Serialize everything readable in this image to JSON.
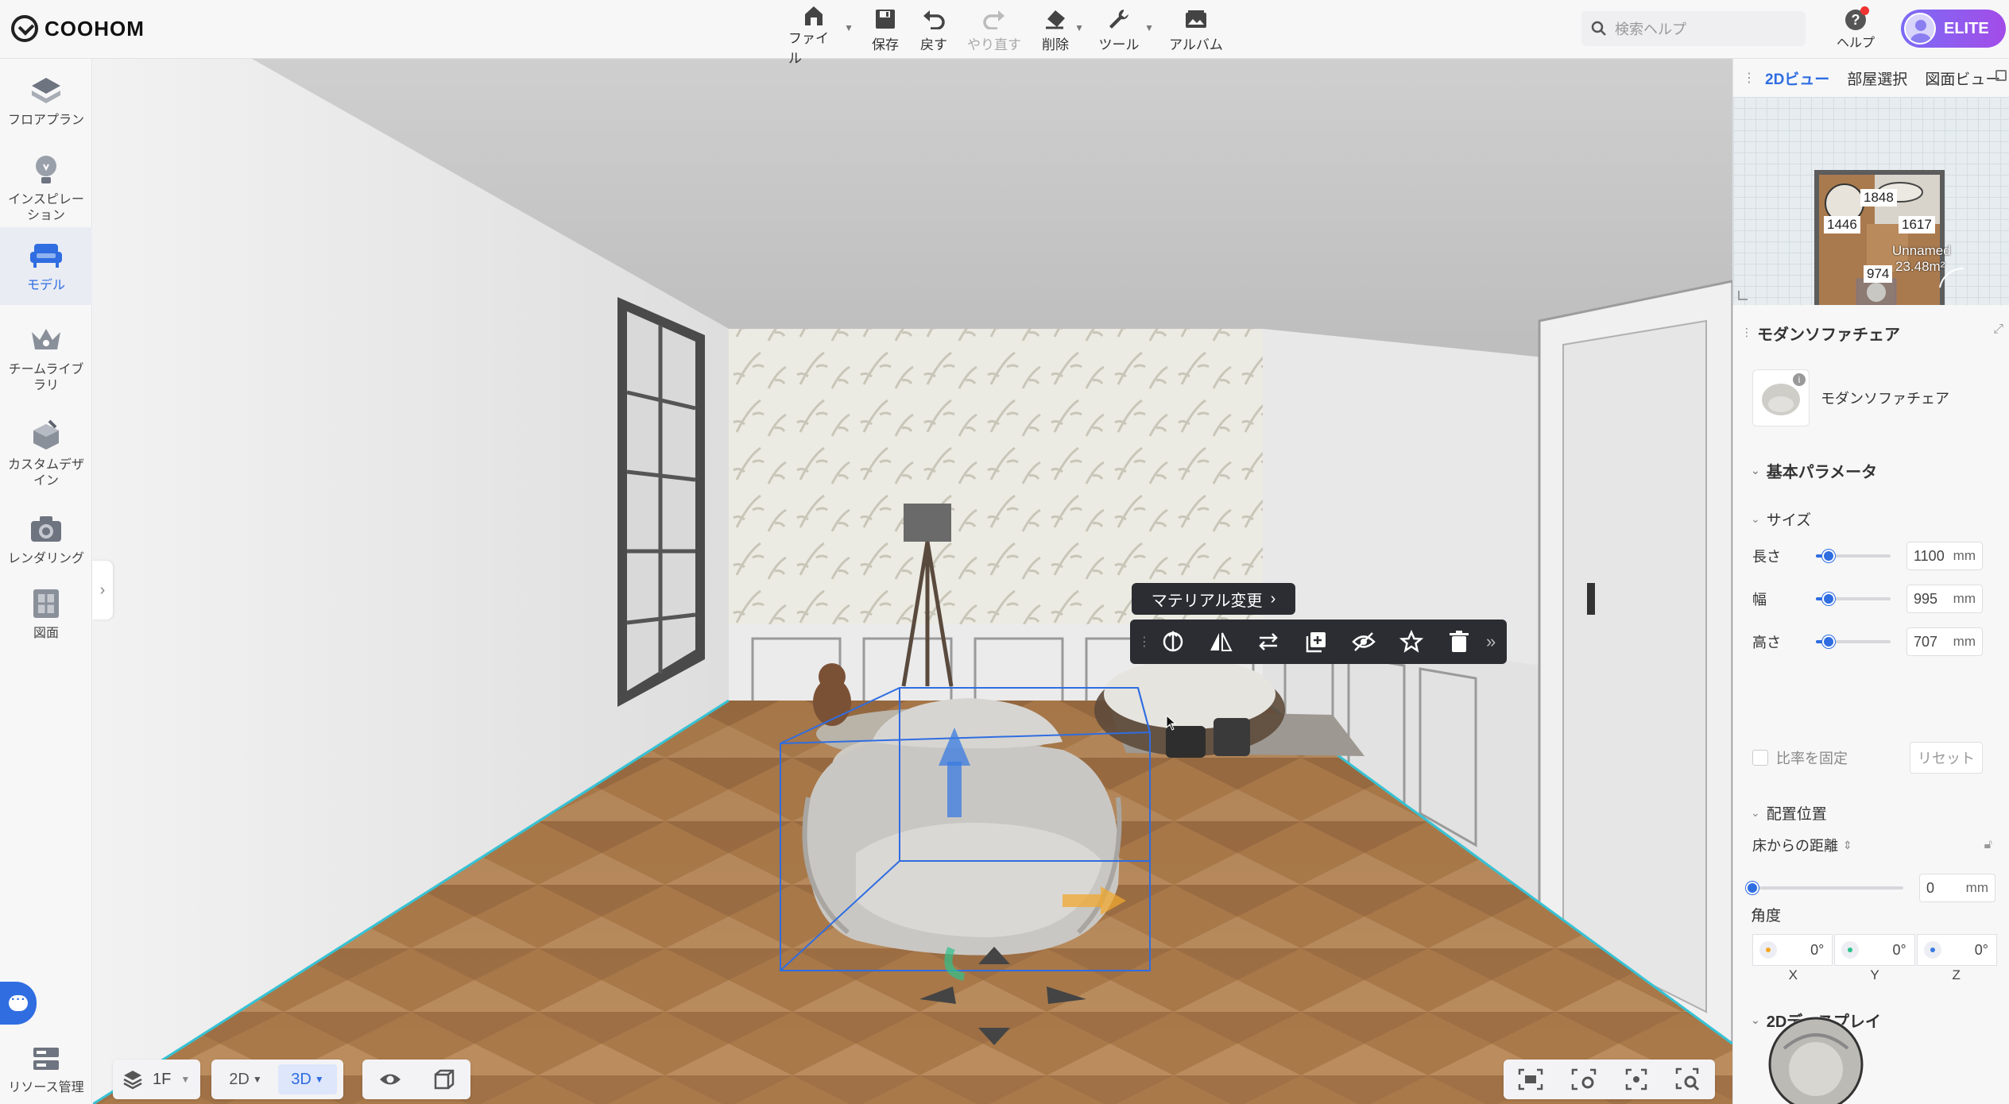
{
  "app": {
    "logo_text": "COOHOM"
  },
  "toolbar": {
    "file": "ファイル",
    "save": "保存",
    "undo": "戻す",
    "redo": "やり直す",
    "delete": "削除",
    "tools": "ツール",
    "album": "アルバム"
  },
  "search": {
    "placeholder": "検索ヘルプ"
  },
  "help": {
    "label": "ヘルプ"
  },
  "account": {
    "tier": "ELITE"
  },
  "sidebar": {
    "items": [
      {
        "label": "フロアプラン",
        "icon": "floorplan-icon"
      },
      {
        "label": "インスピレーション",
        "icon": "lightbulb-icon"
      },
      {
        "label": "モデル",
        "icon": "sofa-icon",
        "active": true
      },
      {
        "label": "チームライブラリ",
        "icon": "crown-icon"
      },
      {
        "label": "カスタムデザイン",
        "icon": "cube-edit-icon"
      },
      {
        "label": "レンダリング",
        "icon": "camera-icon"
      },
      {
        "label": "図面",
        "icon": "drawing-icon"
      }
    ],
    "resource": "リソース管理"
  },
  "viewport": {
    "material_change": "マテリアル変更",
    "floor": "1F",
    "view_2d": "2D",
    "view_3d": "3D"
  },
  "right_panel": {
    "tabs": [
      "2Dビュー",
      "部屋選択",
      "図面ビュー"
    ],
    "minimap": {
      "dim_top": "1848",
      "dim_left": "1446",
      "dim_right": "1617",
      "dim_bottom": "974",
      "room_name": "Unnamed",
      "room_area": "23.48m²"
    },
    "object_title": "モダンソファチェア",
    "object_name": "モダンソファチェア",
    "section_basic": "基本パラメータ",
    "section_size": "サイズ",
    "params": [
      {
        "label": "長さ",
        "value": "1100",
        "unit": "mm",
        "level": 0.17
      },
      {
        "label": "幅",
        "value": "995",
        "unit": "mm",
        "level": 0.17
      },
      {
        "label": "高さ",
        "value": "707",
        "unit": "mm",
        "level": 0.17
      }
    ],
    "lock_ratio": "比率を固定",
    "reset": "リセット",
    "section_position": "配置位置",
    "floor_distance_label": "床からの距離",
    "floor_distance_value": "0",
    "floor_distance_unit": "mm",
    "angle_label": "角度",
    "angles": [
      {
        "axis": "X",
        "value": "0",
        "unit": "°",
        "color": "#f5a623"
      },
      {
        "axis": "Y",
        "value": "0",
        "unit": "°",
        "color": "#2fc28b"
      },
      {
        "axis": "Z",
        "value": "0",
        "unit": "°",
        "color": "#3a7be0"
      }
    ],
    "section_2d": "2Dディスプレイ"
  }
}
